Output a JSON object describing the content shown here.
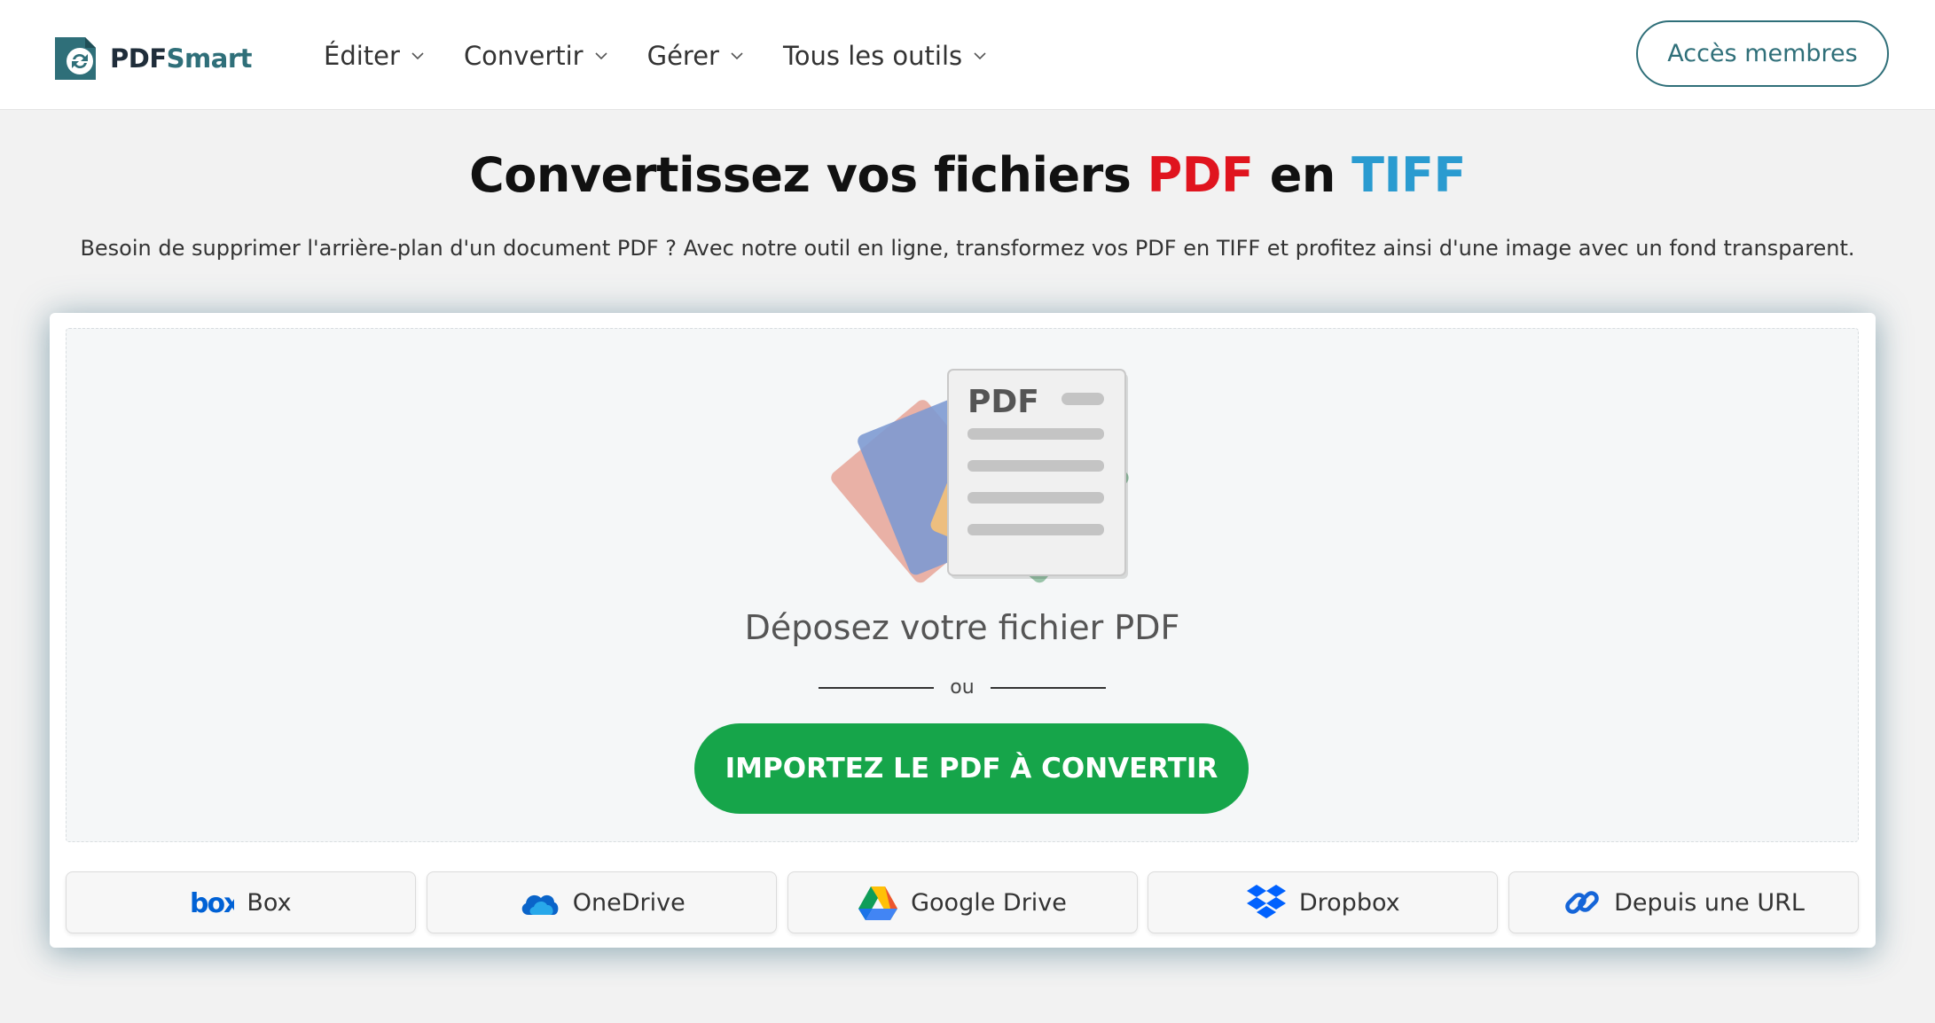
{
  "header": {
    "logo_pdf": "PDF",
    "logo_smart": "Smart",
    "nav": [
      {
        "label": "Éditer"
      },
      {
        "label": "Convertir"
      },
      {
        "label": "Gérer"
      },
      {
        "label": "Tous les outils"
      }
    ],
    "members_label": "Accès membres"
  },
  "hero": {
    "title_prefix": "Convertissez vos fichiers ",
    "title_pdf": "PDF",
    "title_middle": " en ",
    "title_tiff": "TIFF",
    "subtitle": "Besoin de supprimer l'arrière-plan d'un document PDF ? Avec notre outil en ligne, transformez vos PDF en TIFF et profitez ainsi d'une image avec un fond transparent."
  },
  "upload": {
    "illustration_label": "PDF",
    "drop_text": "Déposez votre fichier PDF",
    "or_text": "ou",
    "import_label": "IMPORTEZ LE PDF À CONVERTIR"
  },
  "sources": [
    {
      "label": "Box",
      "icon": "box-icon"
    },
    {
      "label": "OneDrive",
      "icon": "onedrive-icon"
    },
    {
      "label": "Google Drive",
      "icon": "google-drive-icon"
    },
    {
      "label": "Dropbox",
      "icon": "dropbox-icon"
    },
    {
      "label": "Depuis une URL",
      "icon": "link-icon"
    }
  ],
  "colors": {
    "brand_teal": "#2f6f79",
    "import_green": "#16a54a",
    "pdf_red": "#e0141e",
    "tiff_blue": "#2a9bd0"
  }
}
